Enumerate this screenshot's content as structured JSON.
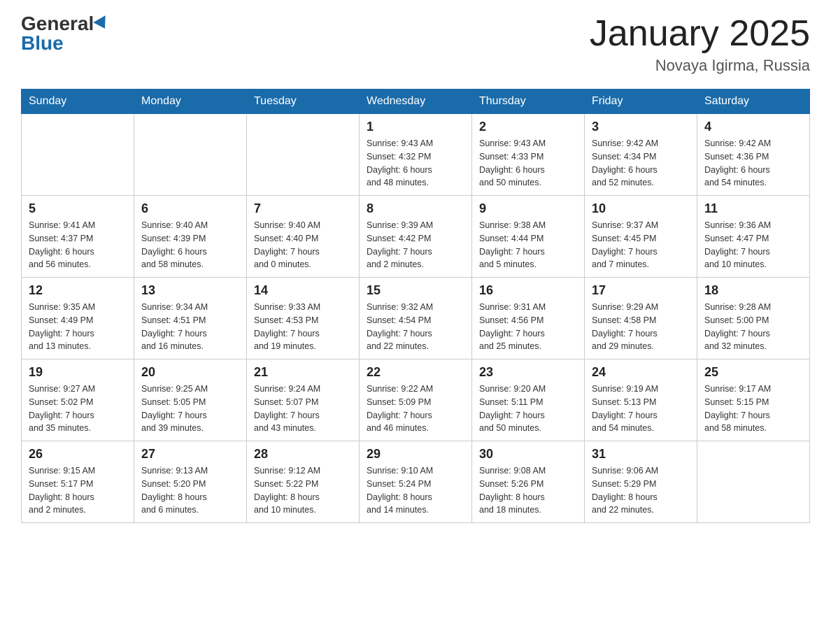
{
  "header": {
    "logo": {
      "general": "General",
      "blue": "Blue",
      "triangle_alt": "triangle logo"
    },
    "title": "January 2025",
    "subtitle": "Novaya Igirma, Russia"
  },
  "weekdays": [
    "Sunday",
    "Monday",
    "Tuesday",
    "Wednesday",
    "Thursday",
    "Friday",
    "Saturday"
  ],
  "weeks": [
    [
      {
        "day": "",
        "info": ""
      },
      {
        "day": "",
        "info": ""
      },
      {
        "day": "",
        "info": ""
      },
      {
        "day": "1",
        "info": "Sunrise: 9:43 AM\nSunset: 4:32 PM\nDaylight: 6 hours\nand 48 minutes."
      },
      {
        "day": "2",
        "info": "Sunrise: 9:43 AM\nSunset: 4:33 PM\nDaylight: 6 hours\nand 50 minutes."
      },
      {
        "day": "3",
        "info": "Sunrise: 9:42 AM\nSunset: 4:34 PM\nDaylight: 6 hours\nand 52 minutes."
      },
      {
        "day": "4",
        "info": "Sunrise: 9:42 AM\nSunset: 4:36 PM\nDaylight: 6 hours\nand 54 minutes."
      }
    ],
    [
      {
        "day": "5",
        "info": "Sunrise: 9:41 AM\nSunset: 4:37 PM\nDaylight: 6 hours\nand 56 minutes."
      },
      {
        "day": "6",
        "info": "Sunrise: 9:40 AM\nSunset: 4:39 PM\nDaylight: 6 hours\nand 58 minutes."
      },
      {
        "day": "7",
        "info": "Sunrise: 9:40 AM\nSunset: 4:40 PM\nDaylight: 7 hours\nand 0 minutes."
      },
      {
        "day": "8",
        "info": "Sunrise: 9:39 AM\nSunset: 4:42 PM\nDaylight: 7 hours\nand 2 minutes."
      },
      {
        "day": "9",
        "info": "Sunrise: 9:38 AM\nSunset: 4:44 PM\nDaylight: 7 hours\nand 5 minutes."
      },
      {
        "day": "10",
        "info": "Sunrise: 9:37 AM\nSunset: 4:45 PM\nDaylight: 7 hours\nand 7 minutes."
      },
      {
        "day": "11",
        "info": "Sunrise: 9:36 AM\nSunset: 4:47 PM\nDaylight: 7 hours\nand 10 minutes."
      }
    ],
    [
      {
        "day": "12",
        "info": "Sunrise: 9:35 AM\nSunset: 4:49 PM\nDaylight: 7 hours\nand 13 minutes."
      },
      {
        "day": "13",
        "info": "Sunrise: 9:34 AM\nSunset: 4:51 PM\nDaylight: 7 hours\nand 16 minutes."
      },
      {
        "day": "14",
        "info": "Sunrise: 9:33 AM\nSunset: 4:53 PM\nDaylight: 7 hours\nand 19 minutes."
      },
      {
        "day": "15",
        "info": "Sunrise: 9:32 AM\nSunset: 4:54 PM\nDaylight: 7 hours\nand 22 minutes."
      },
      {
        "day": "16",
        "info": "Sunrise: 9:31 AM\nSunset: 4:56 PM\nDaylight: 7 hours\nand 25 minutes."
      },
      {
        "day": "17",
        "info": "Sunrise: 9:29 AM\nSunset: 4:58 PM\nDaylight: 7 hours\nand 29 minutes."
      },
      {
        "day": "18",
        "info": "Sunrise: 9:28 AM\nSunset: 5:00 PM\nDaylight: 7 hours\nand 32 minutes."
      }
    ],
    [
      {
        "day": "19",
        "info": "Sunrise: 9:27 AM\nSunset: 5:02 PM\nDaylight: 7 hours\nand 35 minutes."
      },
      {
        "day": "20",
        "info": "Sunrise: 9:25 AM\nSunset: 5:05 PM\nDaylight: 7 hours\nand 39 minutes."
      },
      {
        "day": "21",
        "info": "Sunrise: 9:24 AM\nSunset: 5:07 PM\nDaylight: 7 hours\nand 43 minutes."
      },
      {
        "day": "22",
        "info": "Sunrise: 9:22 AM\nSunset: 5:09 PM\nDaylight: 7 hours\nand 46 minutes."
      },
      {
        "day": "23",
        "info": "Sunrise: 9:20 AM\nSunset: 5:11 PM\nDaylight: 7 hours\nand 50 minutes."
      },
      {
        "day": "24",
        "info": "Sunrise: 9:19 AM\nSunset: 5:13 PM\nDaylight: 7 hours\nand 54 minutes."
      },
      {
        "day": "25",
        "info": "Sunrise: 9:17 AM\nSunset: 5:15 PM\nDaylight: 7 hours\nand 58 minutes."
      }
    ],
    [
      {
        "day": "26",
        "info": "Sunrise: 9:15 AM\nSunset: 5:17 PM\nDaylight: 8 hours\nand 2 minutes."
      },
      {
        "day": "27",
        "info": "Sunrise: 9:13 AM\nSunset: 5:20 PM\nDaylight: 8 hours\nand 6 minutes."
      },
      {
        "day": "28",
        "info": "Sunrise: 9:12 AM\nSunset: 5:22 PM\nDaylight: 8 hours\nand 10 minutes."
      },
      {
        "day": "29",
        "info": "Sunrise: 9:10 AM\nSunset: 5:24 PM\nDaylight: 8 hours\nand 14 minutes."
      },
      {
        "day": "30",
        "info": "Sunrise: 9:08 AM\nSunset: 5:26 PM\nDaylight: 8 hours\nand 18 minutes."
      },
      {
        "day": "31",
        "info": "Sunrise: 9:06 AM\nSunset: 5:29 PM\nDaylight: 8 hours\nand 22 minutes."
      },
      {
        "day": "",
        "info": ""
      }
    ]
  ]
}
